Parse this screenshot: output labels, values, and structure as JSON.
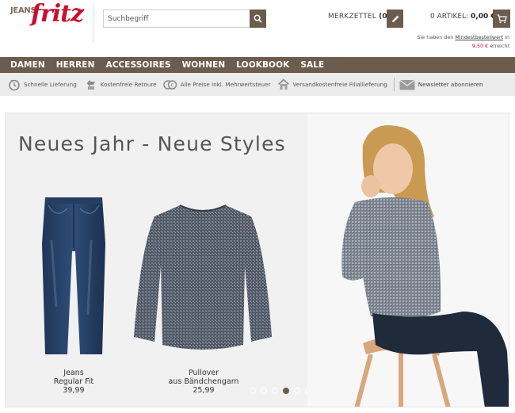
{
  "brand": {
    "jeans": "JEANS",
    "fritz": "fritz",
    "reg": "®"
  },
  "search": {
    "placeholder": "Suchbegriff",
    "value": ""
  },
  "merkzettel": {
    "label": "MERKZETTEL",
    "count": "(0)"
  },
  "cart": {
    "items": "0 ARTIKEL:",
    "total": "0,00 €"
  },
  "min_order": {
    "prefix": "Sie haben den ",
    "link": "Mindestbestellwert",
    "suffix": " in",
    "amount": "9,50 €",
    "end": " erreicht"
  },
  "nav": [
    "DAMEN",
    "HERREN",
    "ACCESSOIRES",
    "WOHNEN",
    "LOOKBOOK",
    "SALE"
  ],
  "usps": [
    {
      "icon": "clock-icon",
      "label": "Schnelle Lieferung"
    },
    {
      "icon": "return-arrow-icon",
      "label": "Kostenfreie Retoure"
    },
    {
      "icon": "coins-icon",
      "label": "Alle Preise inkl. Mehrwertsteuer"
    },
    {
      "icon": "house-icon",
      "label": "Versandkostenfreie Filiallieferung"
    }
  ],
  "newsletter": {
    "icon": "envelope-icon",
    "label": "Newsletter abonnieren"
  },
  "hero": {
    "title": "Neues Jahr - Neue Styles",
    "products": [
      {
        "name1": "Jeans",
        "name2": "Regular Fit",
        "price": "39,99"
      },
      {
        "name1": "Pullover",
        "name2": "aus Bändchengarn",
        "price": "25,99"
      }
    ],
    "slides": 6,
    "active_slide": 4
  },
  "colors": {
    "brand_brown": "#6b5c4d",
    "brand_red": "#c8102e",
    "usp_bar": "#ececec"
  }
}
